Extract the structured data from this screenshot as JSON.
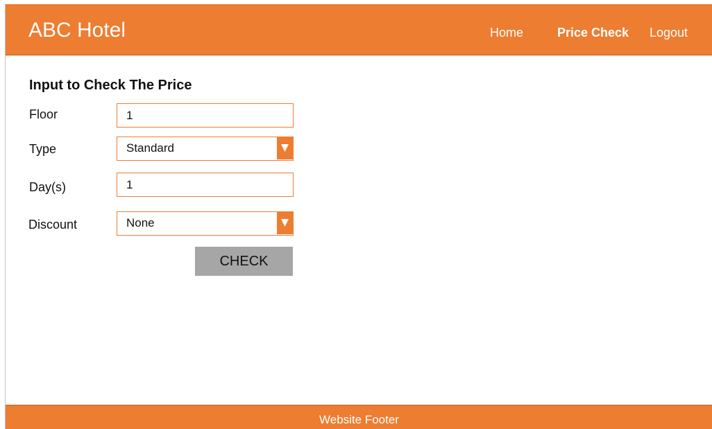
{
  "header": {
    "brand": "ABC Hotel",
    "nav": {
      "home": "Home",
      "price_check": "Price Check",
      "logout": "Logout"
    }
  },
  "form": {
    "title": "Input to Check The Price",
    "floor": {
      "label": "Floor",
      "value": "1"
    },
    "type": {
      "label": "Type",
      "value": "Standard"
    },
    "days": {
      "label": "Day(s)",
      "value": "1"
    },
    "discount": {
      "label": "Discount",
      "value": "None"
    },
    "check_label": "CHECK"
  },
  "footer": {
    "text": "Website Footer"
  },
  "colors": {
    "accent": "#ED7D31",
    "button": "#A6A6A6"
  },
  "icons": {
    "dropdown": "chevron-down-icon"
  }
}
